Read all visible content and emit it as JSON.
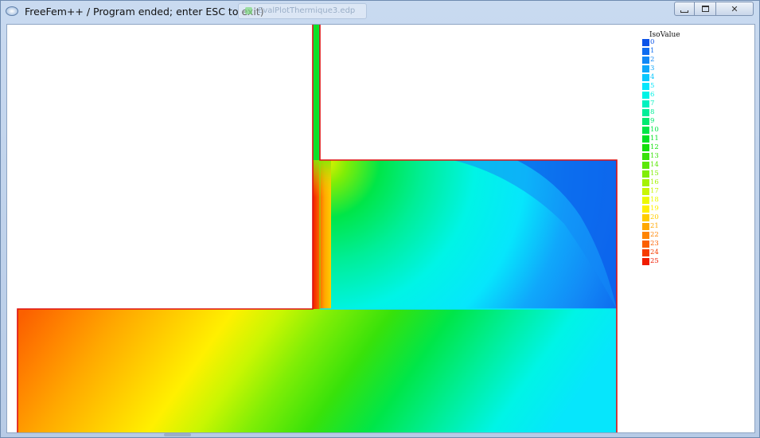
{
  "window": {
    "title": "FreeFem++ / Program ended; enter ESC to exit)",
    "background_tab": "EvalPlotThermique3.edp",
    "minimize_label": "minimize",
    "maximize_label": "maximize",
    "close_label": "close",
    "close_glyph": "✕"
  },
  "legend": {
    "title": "IsoValue",
    "items": [
      {
        "label": "0",
        "color": "#0a52e8"
      },
      {
        "label": "1",
        "color": "#0f6cf0"
      },
      {
        "label": "2",
        "color": "#1288f6"
      },
      {
        "label": "3",
        "color": "#10a8fb"
      },
      {
        "label": "4",
        "color": "#0cc8fe"
      },
      {
        "label": "5",
        "color": "#06e6fc"
      },
      {
        "label": "6",
        "color": "#00f4e6"
      },
      {
        "label": "7",
        "color": "#00f2c0"
      },
      {
        "label": "8",
        "color": "#00ee98"
      },
      {
        "label": "9",
        "color": "#00ea70"
      },
      {
        "label": "10",
        "color": "#00e648"
      },
      {
        "label": "11",
        "color": "#00e225"
      },
      {
        "label": "12",
        "color": "#14e00c"
      },
      {
        "label": "13",
        "color": "#38e20a"
      },
      {
        "label": "14",
        "color": "#5ce808"
      },
      {
        "label": "15",
        "color": "#80ee06"
      },
      {
        "label": "16",
        "color": "#a4f204"
      },
      {
        "label": "17",
        "color": "#c8f602"
      },
      {
        "label": "18",
        "color": "#ecfa00"
      },
      {
        "label": "19",
        "color": "#fff000"
      },
      {
        "label": "20",
        "color": "#ffcc00"
      },
      {
        "label": "21",
        "color": "#ffa800"
      },
      {
        "label": "22",
        "color": "#ff8400"
      },
      {
        "label": "23",
        "color": "#fb6000"
      },
      {
        "label": "24",
        "color": "#f63c00"
      },
      {
        "label": "25",
        "color": "#f01c00"
      }
    ]
  },
  "colors": {
    "boundary": "#dd1111",
    "accent": "#0a52e8"
  }
}
